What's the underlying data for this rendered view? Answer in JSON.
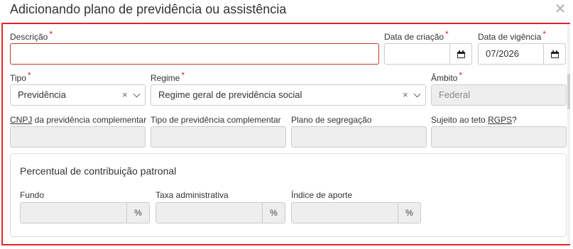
{
  "dialog": {
    "title": "Adicionando plano de previdência ou assistência",
    "close_symbol": "✕"
  },
  "fields": {
    "descricao": {
      "label": "Descrição",
      "required": "*",
      "value": ""
    },
    "data_criacao": {
      "label": "Data de criação",
      "required": "*",
      "value": ""
    },
    "data_vigencia": {
      "label": "Data de vigência",
      "required": "*",
      "value": "07/2026"
    },
    "tipo": {
      "label": "Tipo",
      "required": "*",
      "value": "Previdência",
      "clear": "×"
    },
    "regime": {
      "label": "Regime",
      "required": "*",
      "value": "Regime geral de previdência social",
      "clear": "×"
    },
    "ambito": {
      "label": "Âmbito",
      "required": "*",
      "value": "Federal"
    },
    "cnpj": {
      "label_prefix": "CNPJ",
      "label_rest": " da previdência complementar",
      "value": ""
    },
    "tipo_complementar": {
      "label": "Tipo de previdência complementar",
      "value": ""
    },
    "plano_segregacao": {
      "label": "Plano de segregação",
      "value": ""
    },
    "sujeito_teto": {
      "label_prefix": "Sujeito ao teto ",
      "label_abbr": "RGPS",
      "label_suffix": "?",
      "value": ""
    }
  },
  "contribuicao": {
    "title": "Percentual de contribuição patronal",
    "fundo": {
      "label": "Fundo",
      "value": "",
      "unit": "%"
    },
    "taxa": {
      "label": "Taxa administrativa",
      "value": "",
      "unit": "%"
    },
    "indice": {
      "label": "Índice de aporte",
      "value": "",
      "unit": "%"
    }
  },
  "colors": {
    "required": "#e3242b",
    "highlight_border": "#e3242b",
    "disabled_bg": "#eeeeee"
  },
  "icons": [
    "close-icon",
    "calendar-icon",
    "clear-icon",
    "chevron-down-icon"
  ]
}
